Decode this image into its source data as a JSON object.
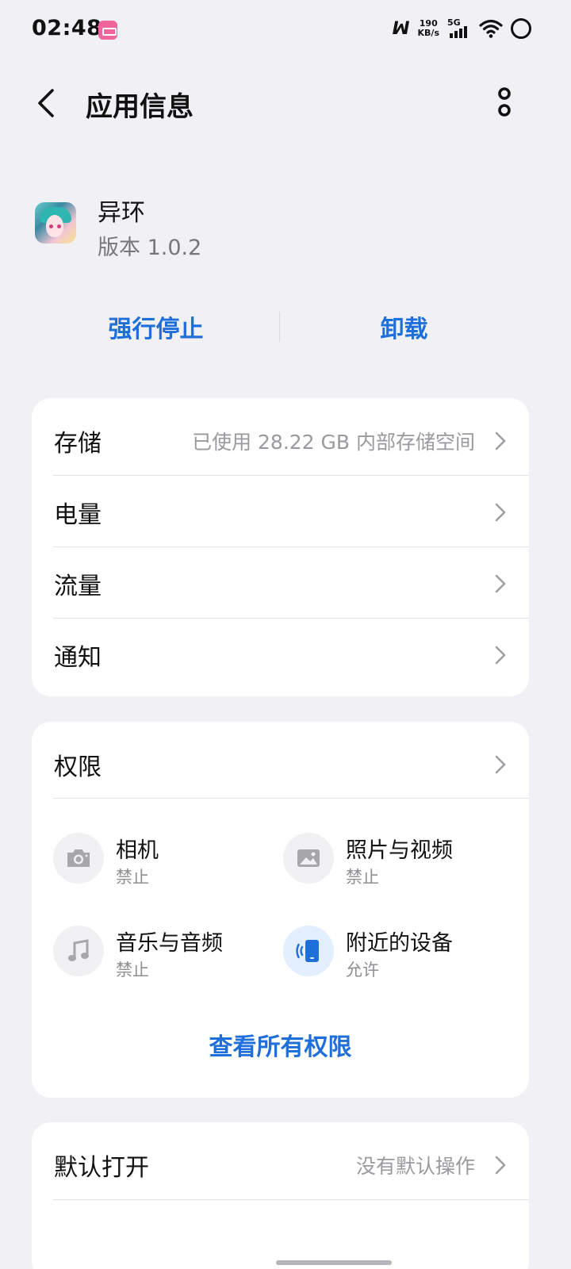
{
  "status_bar": {
    "time": "02:48",
    "network_speed_value": "190",
    "network_speed_unit": "KB/s",
    "network_type": "5G",
    "icons": [
      "bilibili-notification-icon",
      "signal-m-icon",
      "cellular-signal-icon",
      "wifi-icon",
      "battery-ring-icon"
    ]
  },
  "header": {
    "title": "应用信息",
    "back_icon": "chevron-left-icon",
    "more_icon": "more-vertical-icon"
  },
  "app": {
    "name": "异环",
    "version": "版本 1.0.2"
  },
  "actions": {
    "force_stop": "强行停止",
    "uninstall": "卸载"
  },
  "settings": [
    {
      "label": "存储",
      "value": "已使用 28.22 GB 内部存储空间"
    },
    {
      "label": "电量",
      "value": ""
    },
    {
      "label": "流量",
      "value": ""
    },
    {
      "label": "通知",
      "value": ""
    }
  ],
  "permissions": {
    "title": "权限",
    "items": [
      {
        "name": "相机",
        "state": "禁止",
        "icon": "camera-icon",
        "enabled": false
      },
      {
        "name": "照片与视频",
        "state": "禁止",
        "icon": "image-icon",
        "enabled": false
      },
      {
        "name": "音乐与音频",
        "state": "禁止",
        "icon": "music-note-icon",
        "enabled": false
      },
      {
        "name": "附近的设备",
        "state": "允许",
        "icon": "nearby-device-icon",
        "enabled": true
      }
    ],
    "view_all": "查看所有权限"
  },
  "defaults": {
    "label": "默认打开",
    "value": "没有默认操作"
  },
  "colors": {
    "accent": "#1f6fdb",
    "background": "#f1f1f5",
    "card": "#ffffff",
    "secondary_text": "#9a9a9e"
  }
}
